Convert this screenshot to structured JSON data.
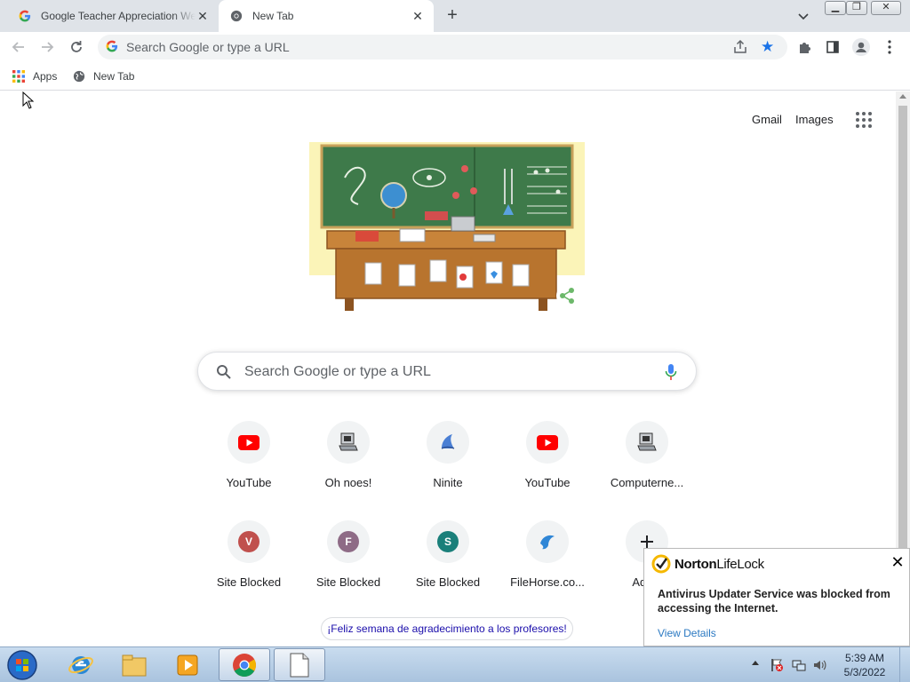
{
  "browser": {
    "tabs": [
      {
        "title": "Google Teacher Appreciation We",
        "favicon": "google-g-icon",
        "active": false
      },
      {
        "title": "New Tab",
        "favicon": "chrome-globe-icon",
        "active": true
      }
    ],
    "new_tab_symbol": "+",
    "omnibox": {
      "placeholder": "Search Google or type a URL",
      "bookmarked": true
    },
    "bookmarks": [
      {
        "label": "Apps",
        "icon": "apps-grid-icon"
      },
      {
        "label": "New Tab",
        "icon": "globe-icon"
      }
    ]
  },
  "ntp": {
    "header_links": {
      "gmail": "Gmail",
      "images": "Images"
    },
    "doodle": {
      "subject": "Teacher Appreciation Week chalkboard doodle",
      "share_icon": "share-icon"
    },
    "search": {
      "placeholder": "Search Google or type a URL"
    },
    "shortcuts": [
      {
        "label": "YouTube",
        "icon": "youtube-icon"
      },
      {
        "label": "Oh noes!",
        "icon": "computer-icon"
      },
      {
        "label": "Ninite",
        "icon": "ninite-icon"
      },
      {
        "label": "YouTube",
        "icon": "youtube-icon"
      },
      {
        "label": "Computerne...",
        "icon": "computer-icon"
      },
      {
        "label": "Site Blocked",
        "icon": "letter-v",
        "letter": "V",
        "color": "#c0504d"
      },
      {
        "label": "Site Blocked",
        "icon": "letter-f",
        "letter": "F",
        "color": "#8e6b86"
      },
      {
        "label": "Site Blocked",
        "icon": "letter-s",
        "letter": "S",
        "color": "#1a7f7a"
      },
      {
        "label": "FileHorse.co...",
        "icon": "filehorse-icon"
      },
      {
        "label": "Add s",
        "icon": "plus-icon"
      }
    ],
    "promo_text": "¡Feliz semana de agradecimiento a los profesores!"
  },
  "norton": {
    "brand_bold": "Norton",
    "brand_rest": "LifeLock",
    "message": "Antivirus Updater Service was blocked from accessing the Internet.",
    "link": "View Details",
    "close_symbol": "✕"
  },
  "taskbar": {
    "time": "5:39 AM",
    "date": "5/3/2022",
    "items": [
      "internet-explorer-icon",
      "file-explorer-icon",
      "media-player-icon",
      "chrome-icon",
      "notepad-icon"
    ]
  },
  "colors": {
    "accent_blue": "#1a73e8",
    "youtube_red": "#ff0000",
    "link_blue": "#2b79c2"
  }
}
